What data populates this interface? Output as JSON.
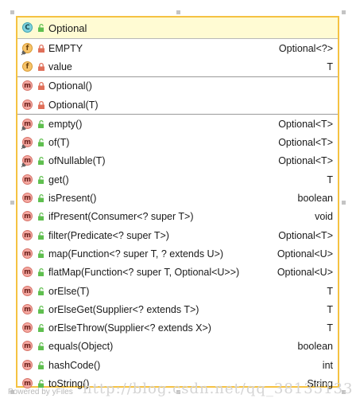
{
  "class_box": {
    "kind_badge": "C",
    "title": "Optional",
    "fields": [
      {
        "badge": "f",
        "visibility": "private",
        "static": true,
        "name": "EMPTY",
        "type": "Optional<?>"
      },
      {
        "badge": "f",
        "visibility": "private",
        "static": false,
        "name": "value",
        "type": "T"
      }
    ],
    "constructors": [
      {
        "badge": "m",
        "visibility": "private",
        "static": false,
        "name": "Optional()",
        "type": ""
      },
      {
        "badge": "m",
        "visibility": "private",
        "static": false,
        "name": "Optional(T)",
        "type": ""
      }
    ],
    "methods": [
      {
        "badge": "m",
        "visibility": "public",
        "static": true,
        "name": "empty()",
        "type": "Optional<T>"
      },
      {
        "badge": "m",
        "visibility": "public",
        "static": true,
        "name": "of(T)",
        "type": "Optional<T>"
      },
      {
        "badge": "m",
        "visibility": "public",
        "static": true,
        "name": "ofNullable(T)",
        "type": "Optional<T>"
      },
      {
        "badge": "m",
        "visibility": "public",
        "static": false,
        "name": "get()",
        "type": "T"
      },
      {
        "badge": "m",
        "visibility": "public",
        "static": false,
        "name": "isPresent()",
        "type": "boolean"
      },
      {
        "badge": "m",
        "visibility": "public",
        "static": false,
        "name": "ifPresent(Consumer<? super T>)",
        "type": "void"
      },
      {
        "badge": "m",
        "visibility": "public",
        "static": false,
        "name": "filter(Predicate<? super T>)",
        "type": "Optional<T>"
      },
      {
        "badge": "m",
        "visibility": "public",
        "static": false,
        "name": "map(Function<? super T, ? extends U>)",
        "type": "Optional<U>"
      },
      {
        "badge": "m",
        "visibility": "public",
        "static": false,
        "name": "flatMap(Function<? super T, Optional<U>>)",
        "type": "Optional<U>"
      },
      {
        "badge": "m",
        "visibility": "public",
        "static": false,
        "name": "orElse(T)",
        "type": "T"
      },
      {
        "badge": "m",
        "visibility": "public",
        "static": false,
        "name": "orElseGet(Supplier<? extends T>)",
        "type": "T"
      },
      {
        "badge": "m",
        "visibility": "public",
        "static": false,
        "name": "orElseThrow(Supplier<? extends X>)",
        "type": "T"
      },
      {
        "badge": "m",
        "visibility": "public",
        "static": false,
        "name": "equals(Object)",
        "type": "boolean"
      },
      {
        "badge": "m",
        "visibility": "public",
        "static": false,
        "name": "hashCode()",
        "type": "int"
      },
      {
        "badge": "m",
        "visibility": "public",
        "static": false,
        "name": "toString()",
        "type": "String"
      }
    ]
  },
  "watermarks": {
    "tool": "Powered by yFiles",
    "site": "http://blog.csdn.net/qq_38135133"
  },
  "colors": {
    "border": "#f5c242",
    "header_bg": "#fffbd3",
    "method_badge": "#f4a7a0",
    "field_badge": "#f7c46a",
    "class_badge": "#7fd1dc",
    "public_lock": "#5fbf4f",
    "private_lock": "#e0705a"
  }
}
